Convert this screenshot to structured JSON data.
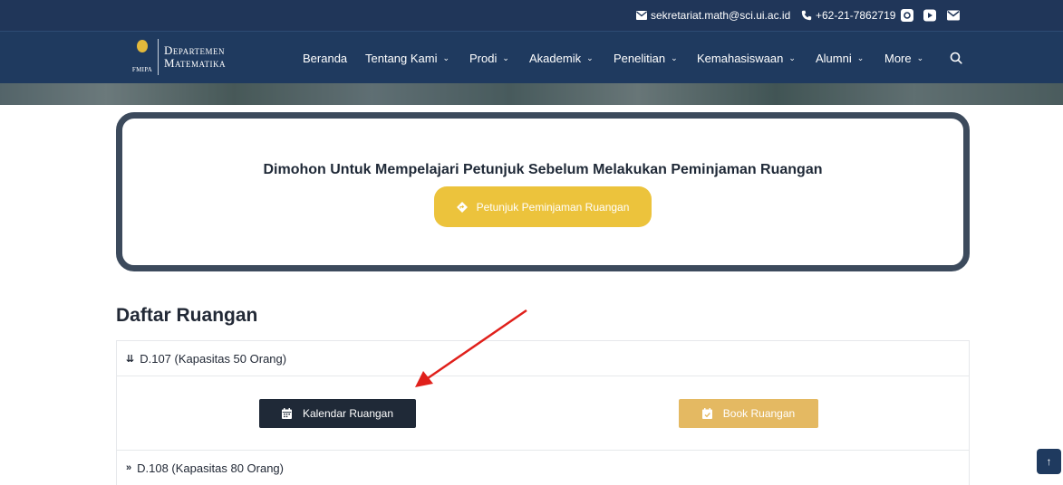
{
  "topbar": {
    "email": "sekretariat.math@sci.ui.ac.id",
    "phone": "+62-21-7862719",
    "social_icons": [
      "instagram-icon",
      "youtube-icon",
      "mail-icon"
    ]
  },
  "logo": {
    "line1": "Departemen",
    "line2": "Matematika",
    "subtext": "FMIPA"
  },
  "nav": {
    "items": [
      {
        "label": "Beranda",
        "has_dropdown": false
      },
      {
        "label": "Tentang Kami",
        "has_dropdown": true
      },
      {
        "label": "Prodi",
        "has_dropdown": true
      },
      {
        "label": "Akademik",
        "has_dropdown": true
      },
      {
        "label": "Penelitian",
        "has_dropdown": true
      },
      {
        "label": "Kemahasiswaan",
        "has_dropdown": true
      },
      {
        "label": "Alumni",
        "has_dropdown": true
      },
      {
        "label": "More",
        "has_dropdown": true
      }
    ],
    "search_icon": "search-icon"
  },
  "notice": {
    "text": "Dimohon Untuk Mempelajari Petunjuk Sebelum Melakukan Peminjaman Ruangan",
    "button_label": "Petunjuk Peminjaman Ruangan"
  },
  "rooms": {
    "title": "Daftar Ruangan",
    "items": [
      {
        "label": "D.107 (Kapasitas 50 Orang)",
        "expanded": true,
        "calendar_label": "Kalendar Ruangan",
        "book_label": "Book Ruangan"
      },
      {
        "label": "D.108 (Kapasitas 80 Orang)",
        "expanded": false
      }
    ]
  },
  "colors": {
    "topbar": "#203659",
    "navbar": "#1f3a5f",
    "notice_border": "#3c4a5c",
    "guide_button": "#ecc33c",
    "calendar_button": "#1f2937",
    "book_button": "#e4b962",
    "annotation_arrow": "#e0201b"
  }
}
